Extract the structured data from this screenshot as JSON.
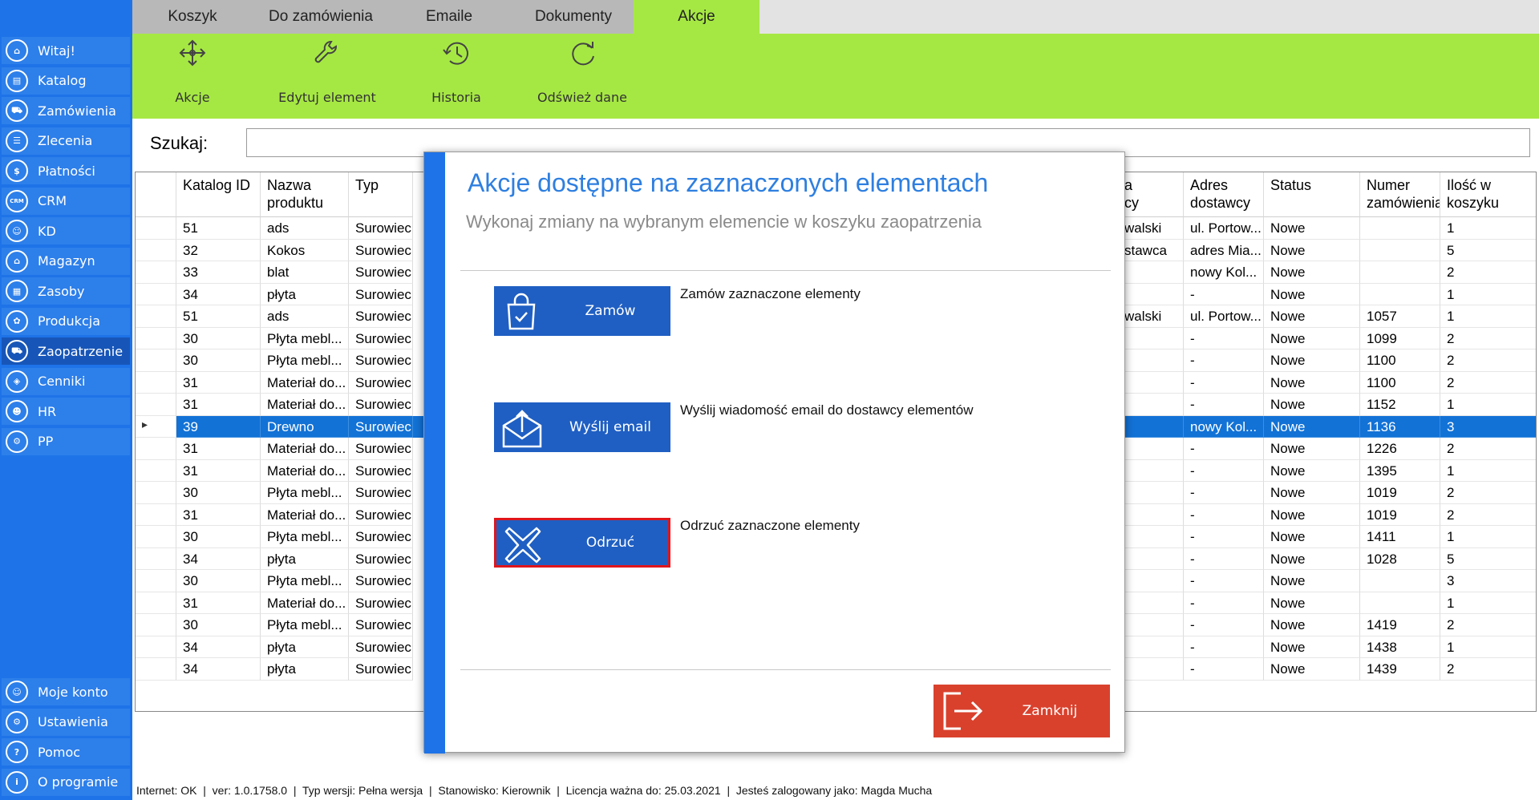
{
  "sidebar": {
    "top_items": [
      {
        "label": "Witaj!",
        "icon": "home-icon"
      },
      {
        "label": "Katalog",
        "icon": "book-icon"
      },
      {
        "label": "Zamówienia",
        "icon": "cart-icon"
      },
      {
        "label": "Zlecenia",
        "icon": "list-icon"
      },
      {
        "label": "Płatności",
        "icon": "dollar-icon"
      },
      {
        "label": "CRM",
        "icon": "crm-icon",
        "glyph": "CRM"
      },
      {
        "label": "KD",
        "icon": "person-icon"
      },
      {
        "label": "Magazyn",
        "icon": "warehouse-icon"
      },
      {
        "label": "Zasoby",
        "icon": "resources-icon"
      },
      {
        "label": "Produkcja",
        "icon": "production-icon"
      },
      {
        "label": "Zaopatrzenie",
        "icon": "supply-icon",
        "active": true
      },
      {
        "label": "Cenniki",
        "icon": "price-tag-icon"
      },
      {
        "label": "HR",
        "icon": "hr-icon"
      },
      {
        "label": "PP",
        "icon": "pp-icon"
      }
    ],
    "bottom_items": [
      {
        "label": "Moje konto",
        "icon": "account-icon"
      },
      {
        "label": "Ustawienia",
        "icon": "gear-icon"
      },
      {
        "label": "Pomoc",
        "icon": "help-icon"
      },
      {
        "label": "O programie",
        "icon": "info-icon"
      }
    ]
  },
  "tabs": [
    {
      "label": "Koszyk"
    },
    {
      "label": "Do zamówienia"
    },
    {
      "label": "Emaile"
    },
    {
      "label": "Dokumenty"
    },
    {
      "label": "Akcje",
      "active": true
    }
  ],
  "toolbar": {
    "items": [
      {
        "label": "Akcje",
        "icon": "move-arrows-icon"
      },
      {
        "label": "Edytuj element",
        "icon": "wrench-icon"
      },
      {
        "label": "Historia",
        "icon": "history-icon"
      },
      {
        "label": "Odśwież dane",
        "icon": "refresh-icon"
      }
    ]
  },
  "search": {
    "label": "Szukaj:",
    "value": ""
  },
  "grid": {
    "columns_left": [
      "Katalog ID",
      "Nazwa produktu",
      "Typ"
    ],
    "columns_right": [
      "a\ncy",
      "Adres dostawcy",
      "Status",
      "Numer zamówienia",
      "Ilość w koszyku"
    ],
    "rows": [
      [
        "51",
        "ads",
        "Surowiec",
        "walski",
        "ul. Portow...",
        "Nowe",
        "",
        "1"
      ],
      [
        "32",
        "Kokos",
        "Surowiec",
        "stawca",
        "adres Mia...",
        "Nowe",
        "",
        "5"
      ],
      [
        "33",
        "blat",
        "Surowiec",
        "",
        "nowy Kol...",
        "Nowe",
        "",
        "2"
      ],
      [
        "34",
        "płyta",
        "Surowiec",
        "",
        "-",
        "Nowe",
        "",
        "1"
      ],
      [
        "51",
        "ads",
        "Surowiec",
        "walski",
        "ul. Portow...",
        "Nowe",
        "1057",
        "1"
      ],
      [
        "30",
        "Płyta mebl...",
        "Surowiec",
        "",
        "-",
        "Nowe",
        "1099",
        "2"
      ],
      [
        "30",
        "Płyta mebl...",
        "Surowiec",
        "",
        "-",
        "Nowe",
        "1100",
        "2"
      ],
      [
        "31",
        "Materiał do...",
        "Surowiec",
        "",
        "-",
        "Nowe",
        "1100",
        "2"
      ],
      [
        "31",
        "Materiał do...",
        "Surowiec",
        "",
        "-",
        "Nowe",
        "1152",
        "1"
      ],
      [
        "39",
        "Drewno",
        "Surowiec",
        "",
        "nowy Kol...",
        "Nowe",
        "1136",
        "3"
      ],
      [
        "31",
        "Materiał do...",
        "Surowiec",
        "",
        "-",
        "Nowe",
        "1226",
        "2"
      ],
      [
        "31",
        "Materiał do...",
        "Surowiec",
        "",
        "-",
        "Nowe",
        "1395",
        "1"
      ],
      [
        "30",
        "Płyta mebl...",
        "Surowiec",
        "",
        "-",
        "Nowe",
        "1019",
        "2"
      ],
      [
        "31",
        "Materiał do...",
        "Surowiec",
        "",
        "-",
        "Nowe",
        "1019",
        "2"
      ],
      [
        "30",
        "Płyta mebl...",
        "Surowiec",
        "",
        "-",
        "Nowe",
        "1411",
        "1"
      ],
      [
        "34",
        "płyta",
        "Surowiec",
        "",
        "-",
        "Nowe",
        "1028",
        "5"
      ],
      [
        "30",
        "Płyta mebl...",
        "Surowiec",
        "",
        "-",
        "Nowe",
        "",
        "3"
      ],
      [
        "31",
        "Materiał do...",
        "Surowiec",
        "",
        "-",
        "Nowe",
        "",
        "1"
      ],
      [
        "30",
        "Płyta mebl...",
        "Surowiec",
        "",
        "-",
        "Nowe",
        "1419",
        "2"
      ],
      [
        "34",
        "płyta",
        "Surowiec",
        "",
        "-",
        "Nowe",
        "1438",
        "1"
      ],
      [
        "34",
        "płyta",
        "Surowiec",
        "",
        "-",
        "Nowe",
        "1439",
        "2"
      ]
    ],
    "selected_row": 9
  },
  "modal": {
    "title": "Akcje dostępne na zaznaczonych elementach",
    "subtitle": "Wykonaj zmiany na wybranym elemencie w koszyku zaopatrzenia",
    "actions": [
      {
        "label": "Zamów",
        "description": "Zamów zaznaczone elementy",
        "icon": "shopping-bag-check-icon"
      },
      {
        "label": "Wyślij email",
        "description": "Wyślij wiadomość email do dostawcy elementów",
        "icon": "envelope-upload-icon"
      },
      {
        "label": "Odrzuć",
        "description": "Odrzuć zaznaczone elementy",
        "icon": "x-mark-icon",
        "focused": true
      }
    ],
    "close_label": "Zamknij",
    "close_icon": "exit-icon"
  },
  "statusbar": {
    "text": "Internet: OK  |  ver: 1.0.1758.0  |  Typ wersji: Pełna wersja  |  Stanowisko: Kierownik  |  Licencja ważna do: 25.03.2021  |  Jesteś zalogowany jako: Magda Mucha"
  },
  "colors": {
    "sidebar": "#1e73e8",
    "accent_green": "#a6e843",
    "selected_row": "#1272d6",
    "action_button": "#1f5fc3",
    "close_button": "#d9412d",
    "title_blue": "#2e7fe0"
  }
}
